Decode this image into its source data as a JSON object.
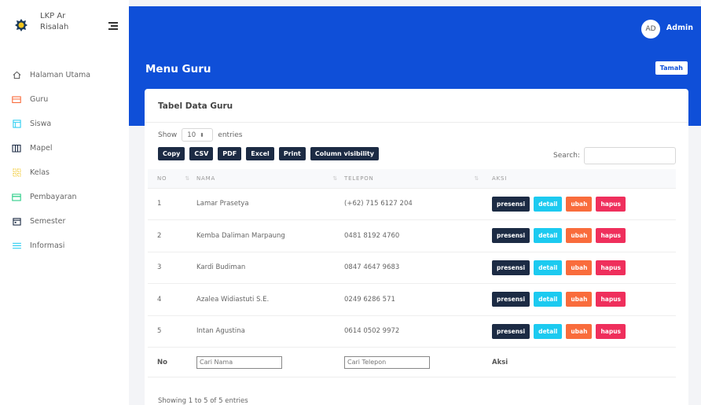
{
  "brand": {
    "name": "LKP Ar Risalah"
  },
  "sidebar": {
    "items": [
      {
        "label": "Halaman Utama",
        "icon": "home-icon",
        "color": "#555555"
      },
      {
        "label": "Guru",
        "icon": "teacher-icon",
        "color": "#f96c3c"
      },
      {
        "label": "Siswa",
        "icon": "student-icon",
        "color": "#1ccaf0"
      },
      {
        "label": "Mapel",
        "icon": "book-icon",
        "color": "#1c2b44"
      },
      {
        "label": "Kelas",
        "icon": "class-icon",
        "color": "#f0c41c"
      },
      {
        "label": "Pembayaran",
        "icon": "payment-icon",
        "color": "#2dce89"
      },
      {
        "label": "Semester",
        "icon": "calendar-icon",
        "color": "#1c2b44"
      },
      {
        "label": "Informasi",
        "icon": "list-icon",
        "color": "#1ccaf0"
      }
    ]
  },
  "header": {
    "avatar_initials": "AD",
    "user_name": "Admin",
    "accent": "#0f4fd8"
  },
  "page": {
    "title": "Menu Guru",
    "add_label": "Tamah"
  },
  "card": {
    "title": "Tabel Data Guru",
    "show_label": "Show",
    "entries_value": "10",
    "entries_label": "entries",
    "export_buttons": [
      "Copy",
      "CSV",
      "PDF",
      "Excel",
      "Print",
      "Column visibility"
    ],
    "search_label": "Search:",
    "columns": [
      "NO",
      "NAMA",
      "TELEPON",
      "AKSI"
    ],
    "rows": [
      {
        "no": "1",
        "nama": "Lamar Prasetya",
        "telepon": "(+62) 715 6127 204"
      },
      {
        "no": "2",
        "nama": "Kemba Daliman Marpaung",
        "telepon": "0481 8192 4760"
      },
      {
        "no": "3",
        "nama": "Kardi Budiman",
        "telepon": "0847 4647 9683"
      },
      {
        "no": "4",
        "nama": "Azalea Widiastuti S.E.",
        "telepon": "0249 6286 571"
      },
      {
        "no": "5",
        "nama": "Intan Agustina",
        "telepon": "0614 0502 9972"
      }
    ],
    "actions": [
      "presensi",
      "detail",
      "ubah",
      "hapus"
    ],
    "footer": {
      "no": "No",
      "nama_placeholder": "Cari Nama",
      "telepon_placeholder": "Cari Telepon",
      "aksi": "Aksi"
    },
    "info": "Showing 1 to 5 of 5 entries"
  }
}
